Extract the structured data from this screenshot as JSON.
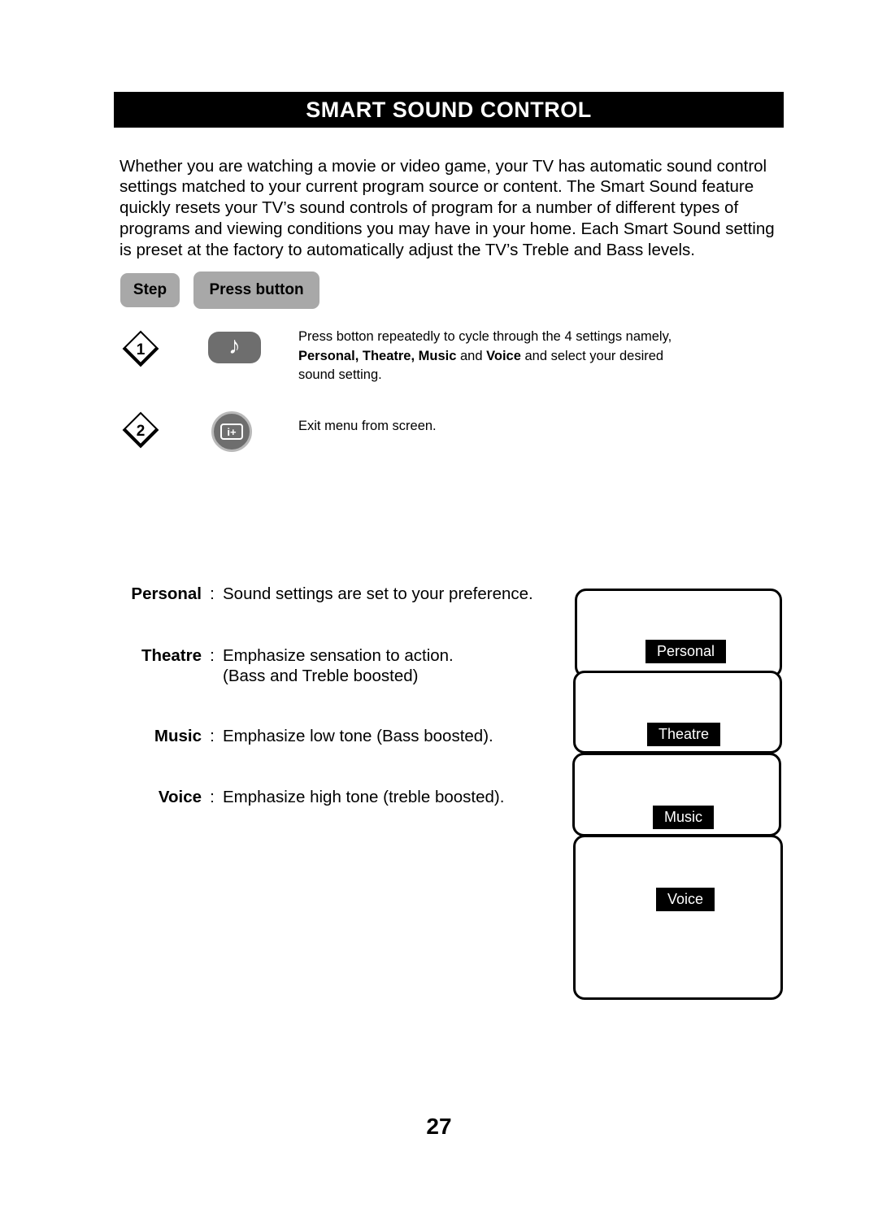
{
  "page": {
    "title": "SMART SOUND CONTROL",
    "number": "27"
  },
  "intro": {
    "paragraph": "Whether you are watching a movie or video game, your TV has automatic sound control settings matched to your current program source or content. The Smart Sound feature quickly resets your TV’s sound controls of program for a number of different types of programs and viewing conditions you may have in your home. Each Smart Sound setting is preset at the factory to automatically adjust the TV’s Treble and Bass levels."
  },
  "table": {
    "headers": {
      "step": "Step",
      "press_button": "Press button"
    },
    "rows": [
      {
        "number": "1",
        "icon": "music-note-button-icon",
        "icon_glyph": "♪",
        "text_plain": "Press botton repeatedly to cycle through the 4 settings namely, Personal, Theatre, Music and Voice and select your desired sound setting.",
        "text_line1": "Press botton repeatedly to cycle through the 4 settings namely,",
        "text_line2_bold_a": "Personal, Theatre, Music",
        "text_line2_mid": " and ",
        "text_line2_bold_b": "Voice",
        "text_line2_tail": " and select your desired",
        "text_line3": "sound setting."
      },
      {
        "number": "2",
        "icon": "info-exit-button-icon",
        "icon_glyph": "i+",
        "text_plain": "Exit menu from screen."
      }
    ]
  },
  "definitions": [
    {
      "term": "Personal",
      "colon": ":",
      "desc": "Sound settings are set to your preference.",
      "desc2": ""
    },
    {
      "term": "Theatre",
      "colon": ":",
      "desc": "Emphasize sensation to action.",
      "desc2": "(Bass and Treble boosted)"
    },
    {
      "term": "Music",
      "colon": ":",
      "desc": "Emphasize low tone (Bass boosted).",
      "desc2": ""
    },
    {
      "term": "Voice",
      "colon": ":",
      "desc": "Emphasize high tone (treble boosted).",
      "desc2": ""
    }
  ],
  "tv_stack": {
    "screens": [
      {
        "osd_label": "Personal"
      },
      {
        "osd_label": "Theatre"
      },
      {
        "osd_label": "Music"
      },
      {
        "osd_label": "Voice"
      }
    ]
  },
  "colors": {
    "title_bar_bg": "#000000",
    "title_bar_text": "#ffffff",
    "pill_bg": "#a8a8a8",
    "key_bg": "#6e6e6e",
    "key_ring": "#b9b9b9",
    "osd_bg": "#000000",
    "osd_text": "#ffffff",
    "page_bg": "#ffffff",
    "body_text": "#000000"
  }
}
